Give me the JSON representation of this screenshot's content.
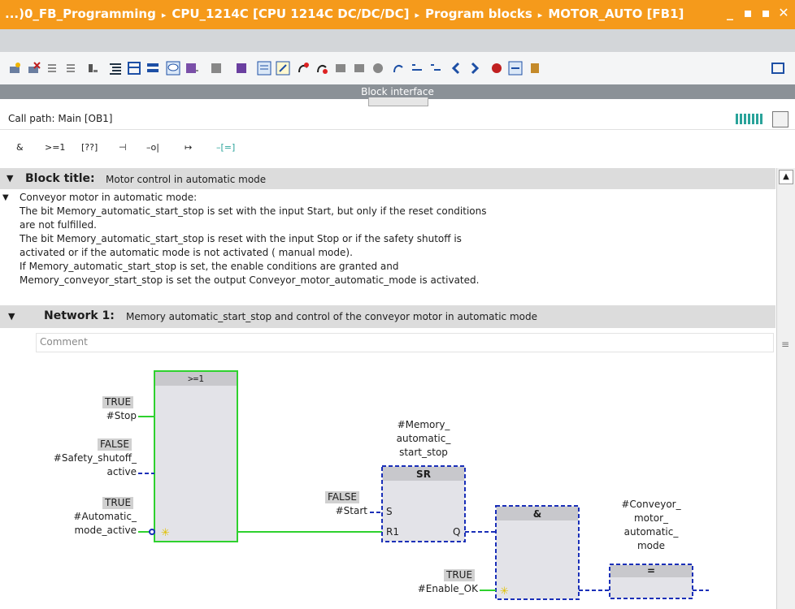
{
  "titlebar": {
    "crumbs": [
      "...)0_FB_Programming",
      "CPU_1214C [CPU 1214C DC/DC/DC]",
      "Program blocks",
      "MOTOR_AUTO [FB1]"
    ],
    "separator": "▸",
    "buttons": [
      "_",
      "▪",
      "▪",
      "✕"
    ]
  },
  "block_interface": {
    "label": "Block interface"
  },
  "call_path": {
    "text": "Call path: Main [OB1]"
  },
  "ladder_toolbar": {
    "items": [
      "&",
      ">=1",
      "[??]",
      "⊣",
      "–o|",
      "↦",
      "–[=]"
    ]
  },
  "block_title": {
    "label": "Block title:",
    "value": "Motor control in automatic mode"
  },
  "description": {
    "lines": [
      "Conveyor motor in automatic mode:",
      "The bit  Memory_automatic_start_stop is set with the input Start, but only if the reset conditions",
      "are not fulfilled.",
      "The bit  Memory_automatic_start_stop is reset with the input Stop or if the safety shutoff is",
      "activated or if the automatic mode is not activated ( manual mode).",
      "If Memory_automatic_start_stop is set, the enable conditions are granted and",
      "Memory_conveyor_start_stop is set the output Conveyor_motor_automatic_mode is activated."
    ]
  },
  "network1": {
    "label": "Network 1:",
    "title": "Memory automatic_start_stop and control of the conveyor motor in automatic mode",
    "comment_placeholder": "Comment",
    "or_block": {
      "label": ">=1"
    },
    "stop": {
      "state": "TRUE",
      "operand": "#Stop"
    },
    "safety": {
      "state": "FALSE",
      "operand_l1": "#Safety_shutoff_",
      "operand_l2": "active"
    },
    "auto": {
      "state": "TRUE",
      "operand_l1": "#Automatic_",
      "operand_l2": "mode_active"
    },
    "sr_block": {
      "label": "SR",
      "operand_l1": "#Memory_",
      "operand_l2": "automatic_",
      "operand_l3": "start_stop",
      "pin_s": "S",
      "pin_r1": "R1",
      "pin_q": "Q"
    },
    "start": {
      "state": "FALSE",
      "operand": "#Start"
    },
    "and_block": {
      "label": "&"
    },
    "enable": {
      "state": "TRUE",
      "operand": "#Enable_OK"
    },
    "assign_block": {
      "label": "=",
      "operand_l1": "#Conveyor_",
      "operand_l2": "motor_",
      "operand_l3": "automatic_",
      "operand_l4": "mode"
    }
  },
  "colors": {
    "title_bg": "#f59a1b",
    "active_green": "#2ed12e",
    "inactive_blue": "#1a2fb8",
    "teal": "#2aa39a"
  }
}
